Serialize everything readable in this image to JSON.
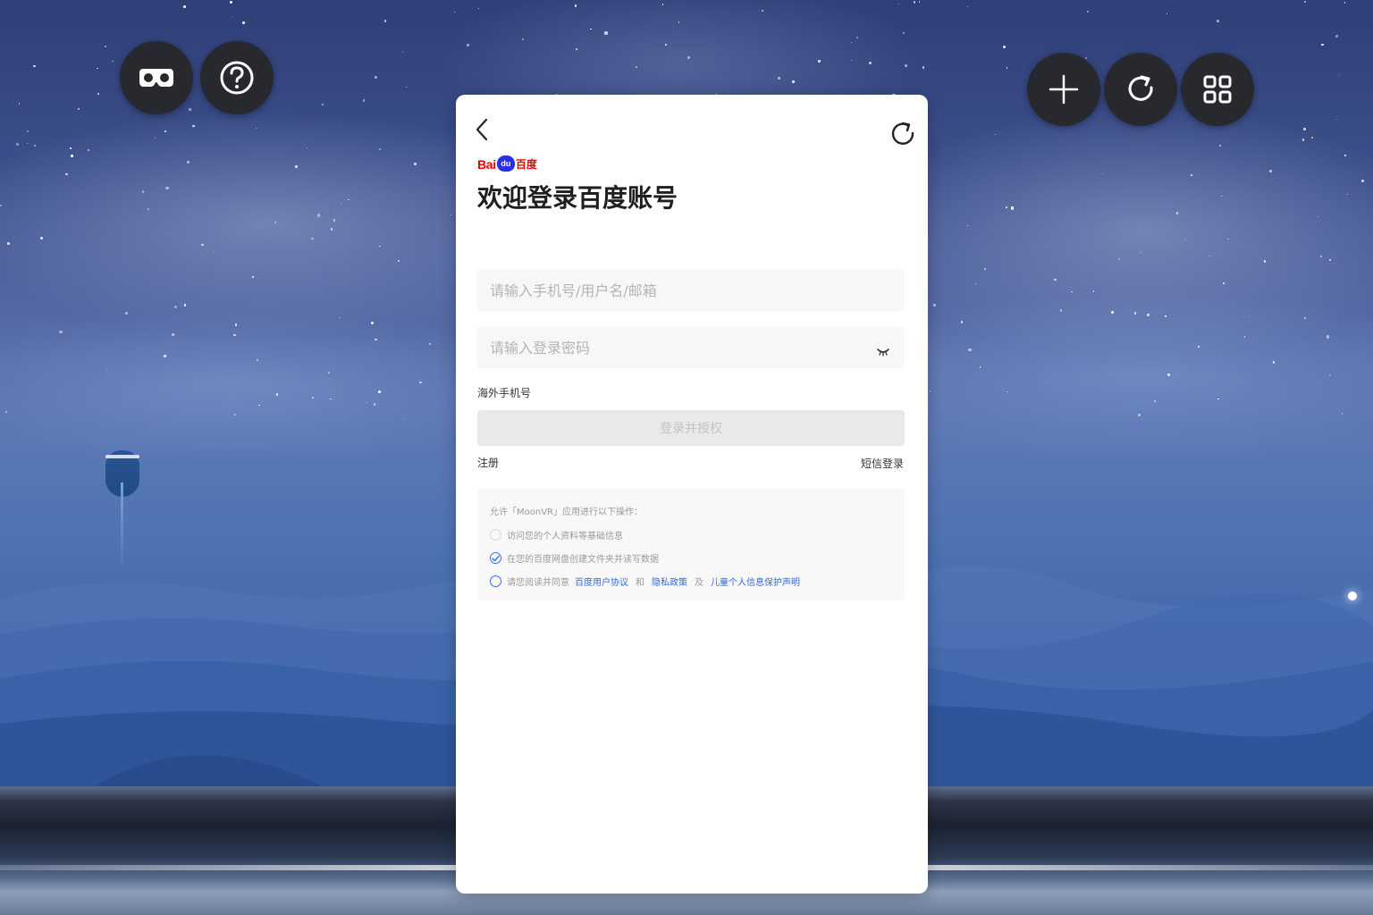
{
  "toolbar": {
    "vr_mode_icon": "vr-goggles-icon",
    "help_icon": "help-circle-icon",
    "add_icon": "plus-icon",
    "refresh_icon": "refresh-icon",
    "apps_icon": "grid-icon"
  },
  "login": {
    "back_icon": "chevron-left-icon",
    "reload_icon": "reload-icon",
    "logo": {
      "bai": "Bai",
      "du": "du",
      "cn": "百度"
    },
    "title": "欢迎登录百度账号",
    "username_placeholder": "请输入手机号/用户名/邮箱",
    "password_placeholder": "请输入登录密码",
    "overseas_label": "海外手机号",
    "submit_label": "登录并授权",
    "register_label": "注册",
    "sms_login_label": "短信登录",
    "authorization": {
      "intro": "允许「MoonVR」应用进行以下操作：",
      "items": [
        {
          "label": "访问您的个人资料等基础信息",
          "checked": false
        },
        {
          "label": "在您的百度网盘创建文件夹并读写数据",
          "checked": true
        }
      ],
      "agreement": {
        "prefix": "请您阅读并同意",
        "link1": "百度用户协议",
        "and": "和",
        "link2": "隐私政策",
        "also": "及",
        "link3": "儿童个人信息保护声明",
        "checked": false
      }
    }
  },
  "colors": {
    "brand_red": "#e10602",
    "brand_blue": "#2932e1",
    "link_blue": "#2d6bd9",
    "fab_bg": "#27292f"
  }
}
